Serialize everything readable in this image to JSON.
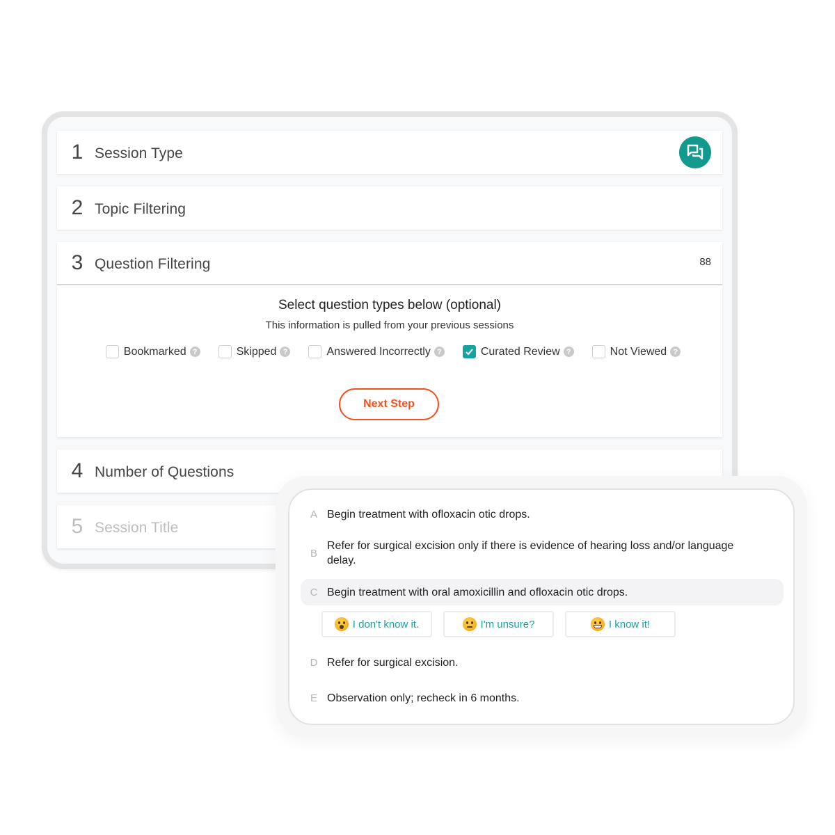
{
  "steps": [
    {
      "number": "1",
      "title": "Session Type",
      "icon": "chat-bubbles-icon"
    },
    {
      "number": "2",
      "title": "Topic Filtering"
    },
    {
      "number": "3",
      "title": "Question Filtering",
      "count": "88"
    },
    {
      "number": "4",
      "title": "Number of Questions"
    },
    {
      "number": "5",
      "title": "Session Title"
    }
  ],
  "question_filtering": {
    "heading": "Select question types below (optional)",
    "subheading": "This information is pulled from your previous sessions",
    "options": [
      {
        "label": "Bookmarked",
        "checked": false
      },
      {
        "label": "Skipped",
        "checked": false
      },
      {
        "label": "Answered Incorrectly",
        "checked": false
      },
      {
        "label": "Curated Review",
        "checked": true
      },
      {
        "label": "Not Viewed",
        "checked": false
      }
    ],
    "help_glyph": "?",
    "next_button": "Next Step"
  },
  "question_card": {
    "answers": [
      {
        "letter": "A",
        "text": "Begin treatment with ofloxacin otic drops."
      },
      {
        "letter": "B",
        "text": "Refer for surgical excision only if there is evidence of hearing loss and/or language delay."
      },
      {
        "letter": "C",
        "text": "Begin treatment with oral amoxicillin and ofloxacin otic drops.",
        "selected": true
      },
      {
        "letter": "D",
        "text": "Refer for surgical excision."
      },
      {
        "letter": "E",
        "text": "Observation only; recheck in 6 months."
      }
    ],
    "confidence_buttons": [
      {
        "label": "I don't know it.",
        "emoji": "surprised-face"
      },
      {
        "label": "I'm unsure?",
        "emoji": "thinking-face"
      },
      {
        "label": "I know it!",
        "emoji": "grinning-face"
      }
    ]
  },
  "colors": {
    "accent_teal": "#17a2a0",
    "chat_icon_bg": "#129a8e",
    "next_button": "#f4511e"
  }
}
